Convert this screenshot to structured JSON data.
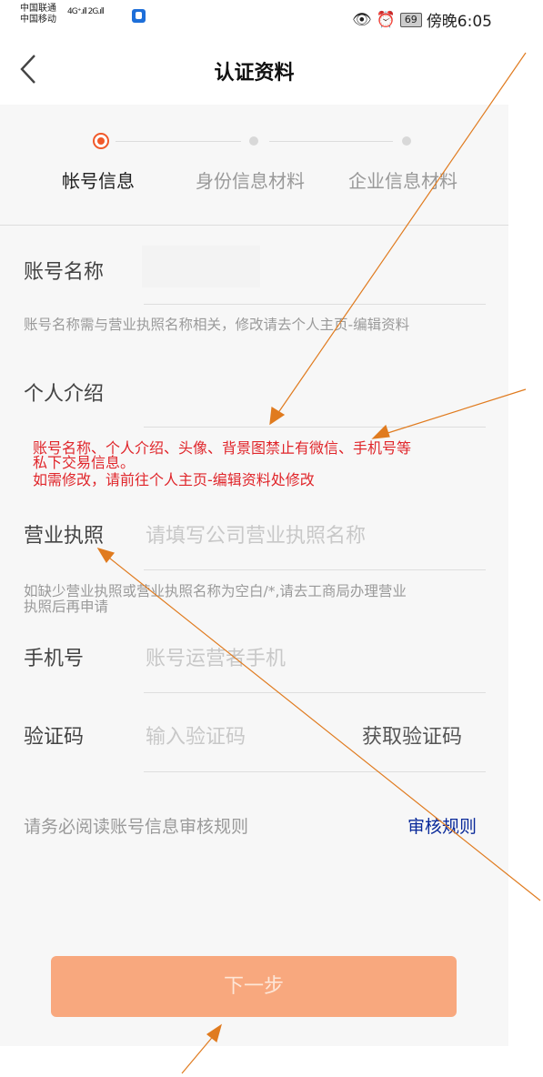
{
  "status_bar": {
    "carrier_1": "中国联通",
    "carrier_2": "中国移动",
    "signal_text": "4G⁺.ıll  2G.ıll",
    "battery": "69",
    "time": "傍晚6:05"
  },
  "header": {
    "title": "认证资料"
  },
  "steps": [
    {
      "label": "帐号信息",
      "active": true
    },
    {
      "label": "身份信息材料",
      "active": false
    },
    {
      "label": "企业信息材料",
      "active": false
    }
  ],
  "form": {
    "account_name": {
      "label": "账号名称",
      "hint": "账号名称需与营业执照名称相关，修改请去个人主页-编辑资料"
    },
    "intro": {
      "label": "个人介绍"
    },
    "notice": {
      "line1": "账号名称、个人介绍、头像、背景图禁止有微信、手机号等",
      "line2": "私下交易信息。",
      "line3": "如需修改，请前往个人主页-编辑资料处修改"
    },
    "license": {
      "label": "营业执照",
      "placeholder": "请填写公司营业执照名称",
      "hint_line1": "如缺少营业执照或营业执照名称为空白/*,请去工商局办理营业",
      "hint_line2": "执照后再申请"
    },
    "phone": {
      "label": "手机号",
      "placeholder": "账号运营者手机"
    },
    "code": {
      "label": "验证码",
      "placeholder": "输入验证码",
      "get_code": "获取验证码"
    }
  },
  "rules": {
    "note": "请务必阅读账号信息审核规则",
    "link": "审核规则"
  },
  "next_button": "下一步",
  "colors": {
    "accent": "#f1592a",
    "button": "#f8a87e",
    "notice": "#e0262b",
    "link": "#0a2a9a",
    "annotation": "#e07b1f"
  }
}
